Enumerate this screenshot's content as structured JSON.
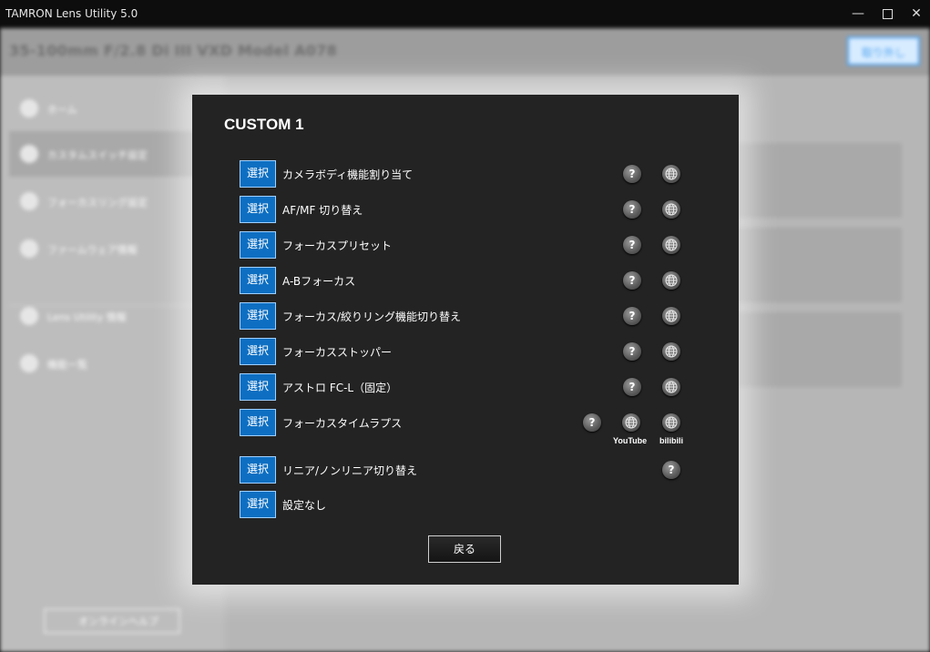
{
  "window": {
    "title": "TAMRON Lens Utility  5.0",
    "minimize": "—",
    "close": "✕"
  },
  "background": {
    "lens_name": "35-100mm F/2.8 Di III VXD    Model A078",
    "back_button": "取り外し",
    "sidebar": [
      {
        "label": "ホーム",
        "icon": "home-icon"
      },
      {
        "label": "カスタムスイッチ設定",
        "icon": "switch-icon"
      },
      {
        "label": "フォーカスリング設定",
        "icon": "ring-icon"
      },
      {
        "label": "ファームウェア情報",
        "icon": "firmware-icon"
      },
      {
        "label": "Lens Utility 情報",
        "icon": "info-icon"
      },
      {
        "label": "機能一覧",
        "icon": "list-icon"
      }
    ],
    "help_button": "オンラインヘルプ"
  },
  "dialog": {
    "title": "CUSTOM 1",
    "select_label": "選択",
    "help_glyph": "?",
    "rows": [
      {
        "label": "カメラボディ機能割り当て"
      },
      {
        "label": "AF/MF 切り替え"
      },
      {
        "label": "フォーカスプリセット"
      },
      {
        "label": "A-Bフォーカス"
      },
      {
        "label": "フォーカス/絞りリング機能切り替え"
      },
      {
        "label": "フォーカスストッパー"
      },
      {
        "label": "アストロ FC-L（固定）"
      },
      {
        "label": "フォーカスタイムラプス",
        "youtube": "YouTube",
        "bilibili": "bilibili"
      },
      {
        "label": "リニア/ノンリニア切り替え"
      },
      {
        "label": "設定なし"
      }
    ],
    "back_button": "戻る"
  },
  "colors": {
    "accent": "#0e6fc2",
    "dialog_bg": "#232323"
  }
}
